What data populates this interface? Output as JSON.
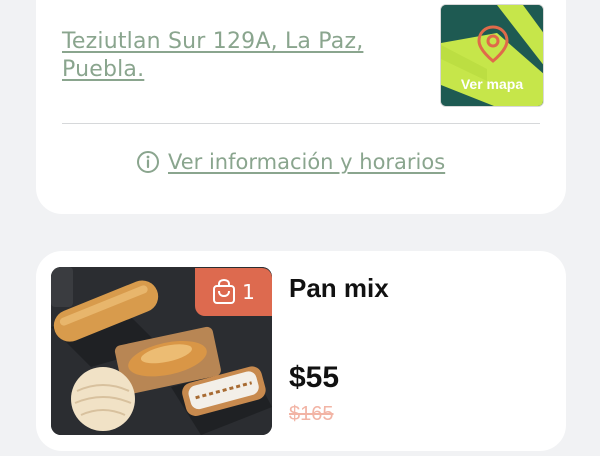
{
  "store": {
    "address": "Teziutlan Sur 129A, La Paz, Puebla.",
    "map_button_label": "Ver mapa",
    "info_link_label": "Ver información y horarios",
    "info_icon": "info-circle-icon",
    "map_icon": "location-pin-icon"
  },
  "product": {
    "title": "Pan mix",
    "price": "$55",
    "original_price": "$165",
    "cart_count": "1",
    "cart_icon": "shopping-bag-icon",
    "badge_color": "#dd6a4f"
  },
  "colors": {
    "accent_green": "#8aa58e",
    "map_background": "#1e5a52",
    "map_road": "#c6e64a",
    "strikethrough_price": "#f2b4a5",
    "page_background": "#f1f2f4"
  }
}
